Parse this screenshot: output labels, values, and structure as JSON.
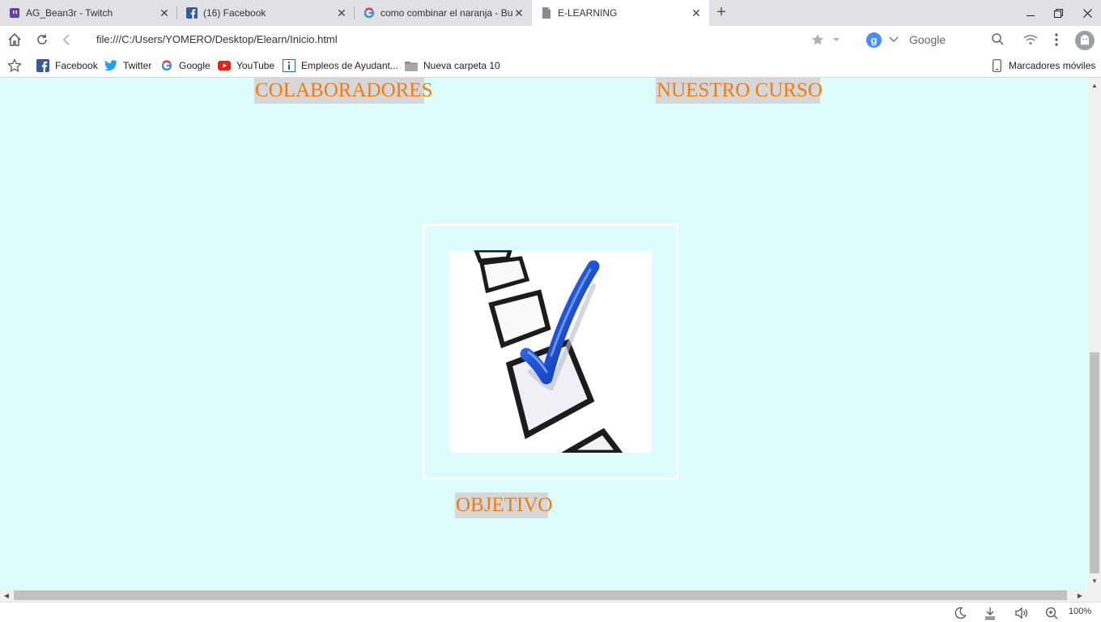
{
  "tabs": [
    {
      "title": "AG_Bean3r - Twitch",
      "favicon": "twitch-icon"
    },
    {
      "title": "(16) Facebook",
      "favicon": "facebook-icon"
    },
    {
      "title": "como combinar el naranja - Bu",
      "favicon": "google-icon"
    },
    {
      "title": "E-LEARNING",
      "favicon": "page-icon",
      "active": true
    }
  ],
  "address_bar": {
    "url": "file:///C:/Users/YOMERO/Desktop/Elearn/Inicio.html"
  },
  "search": {
    "engine": "Google",
    "placeholder": "Google"
  },
  "bookmarks": [
    {
      "label": "Facebook",
      "icon": "facebook-icon"
    },
    {
      "label": "Twitter",
      "icon": "twitter-icon"
    },
    {
      "label": "Google",
      "icon": "google-icon"
    },
    {
      "label": "YouTube",
      "icon": "youtube-icon"
    },
    {
      "label": "Empleos de Ayudant...",
      "icon": "info-icon"
    },
    {
      "label": "Nueva carpeta 10",
      "icon": "folder-icon"
    }
  ],
  "mobile_bookmarks": "Marcadores móviles",
  "page": {
    "links": {
      "colaboradores": "COLABORADORES",
      "nuestro_curso": "NUESTRO CURSO",
      "objetivo": "OBJETIVO"
    },
    "image": {
      "subject": "checklist-checkmark-icon"
    }
  },
  "status": {
    "zoom": "100%"
  },
  "colors": {
    "page_background": "#dcfdfc",
    "link_text": "#f27b16",
    "link_background": "#d6d8d8",
    "tabstrip": "#dfe1e5"
  }
}
